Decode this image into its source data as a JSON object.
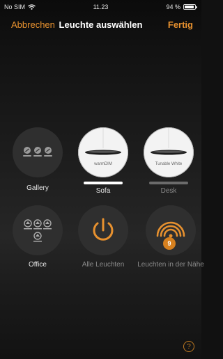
{
  "status": {
    "carrier": "No SIM",
    "time": "11.23",
    "battery": "94 %",
    "battery_level": 0.94
  },
  "nav": {
    "cancel": "Abbrechen",
    "title": "Leuchte auswählen",
    "done": "Fertig"
  },
  "colors": {
    "accent": "#e7912f",
    "background": "#1e1e1e"
  },
  "tiles": [
    {
      "label": "Gallery",
      "icon": "group-lamps-icon"
    },
    {
      "label": "Sofa",
      "lamp_mode": "warmDIM",
      "icon": "pendant-lamp-icon",
      "selected": true
    },
    {
      "label": "Desk",
      "lamp_mode": "Tunable White",
      "icon": "pendant-lamp-icon",
      "selected": false
    },
    {
      "label": "Office",
      "icon": "group-lamps-icon"
    },
    {
      "label": "Alle Leuchten",
      "icon": "power-icon"
    },
    {
      "label": "Leuchten in der Nähe",
      "icon": "nearby-signal-icon",
      "badge": "9"
    }
  ],
  "help_icon": "?"
}
